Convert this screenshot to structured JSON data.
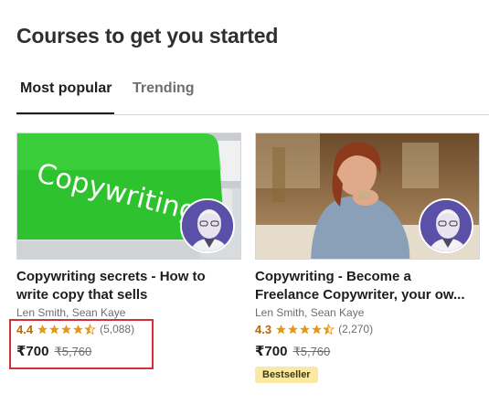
{
  "page": {
    "title": "Courses to get you started"
  },
  "tabs": [
    {
      "label": "Most popular",
      "active": true
    },
    {
      "label": "Trending",
      "active": false
    }
  ],
  "courses": [
    {
      "thumbnail_text": "Copywriting",
      "title": "Copywriting secrets - How to write copy that sells",
      "title_line1": "Copywriting secrets - How to",
      "title_line2": "write copy that sells",
      "instructors": "Len Smith, Sean Kaye",
      "rating": "4.4",
      "rating_value": 4.4,
      "rating_count": "(5,088)",
      "price": "₹700",
      "original_price": "₹5,760",
      "badge": ""
    },
    {
      "title": "Copywriting - Become a Freelance Copywriter, your ow…",
      "title_line1": "Copywriting - Become a",
      "title_line2": "Freelance Copywriter, your ow...",
      "instructors": "Len Smith, Sean Kaye",
      "rating": "4.3",
      "rating_value": 4.3,
      "rating_count": "(2,270)",
      "price": "₹700",
      "original_price": "₹5,760",
      "badge": "Bestseller"
    }
  ],
  "colors": {
    "rating": "#b4690e",
    "highlight": "#d32f3c",
    "badge_bg": "#fbe8a3",
    "thumb_green": "#3ccf3c"
  },
  "icons": [
    "star-full-icon",
    "star-half-icon",
    "instructor-avatar"
  ]
}
